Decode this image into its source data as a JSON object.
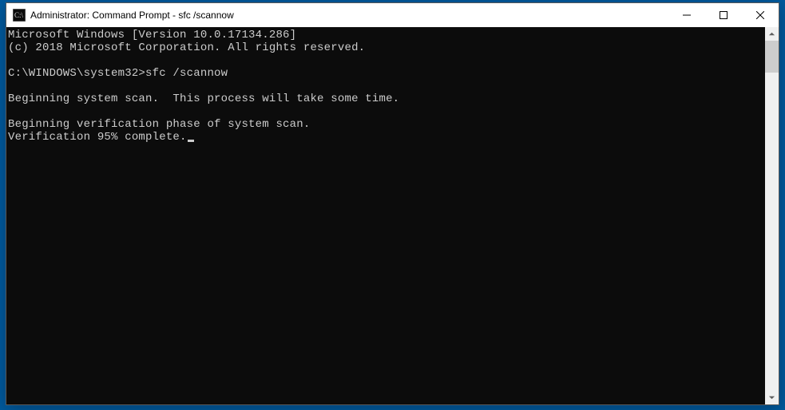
{
  "window": {
    "title": "Administrator: Command Prompt - sfc  /scannow"
  },
  "console": {
    "line1": "Microsoft Windows [Version 10.0.17134.286]",
    "line2": "(c) 2018 Microsoft Corporation. All rights reserved.",
    "blank1": "",
    "prompt": "C:\\WINDOWS\\system32>",
    "command": "sfc /scannow",
    "blank2": "",
    "line3": "Beginning system scan.  This process will take some time.",
    "blank3": "",
    "line4": "Beginning verification phase of system scan.",
    "line5": "Verification 95% complete."
  }
}
